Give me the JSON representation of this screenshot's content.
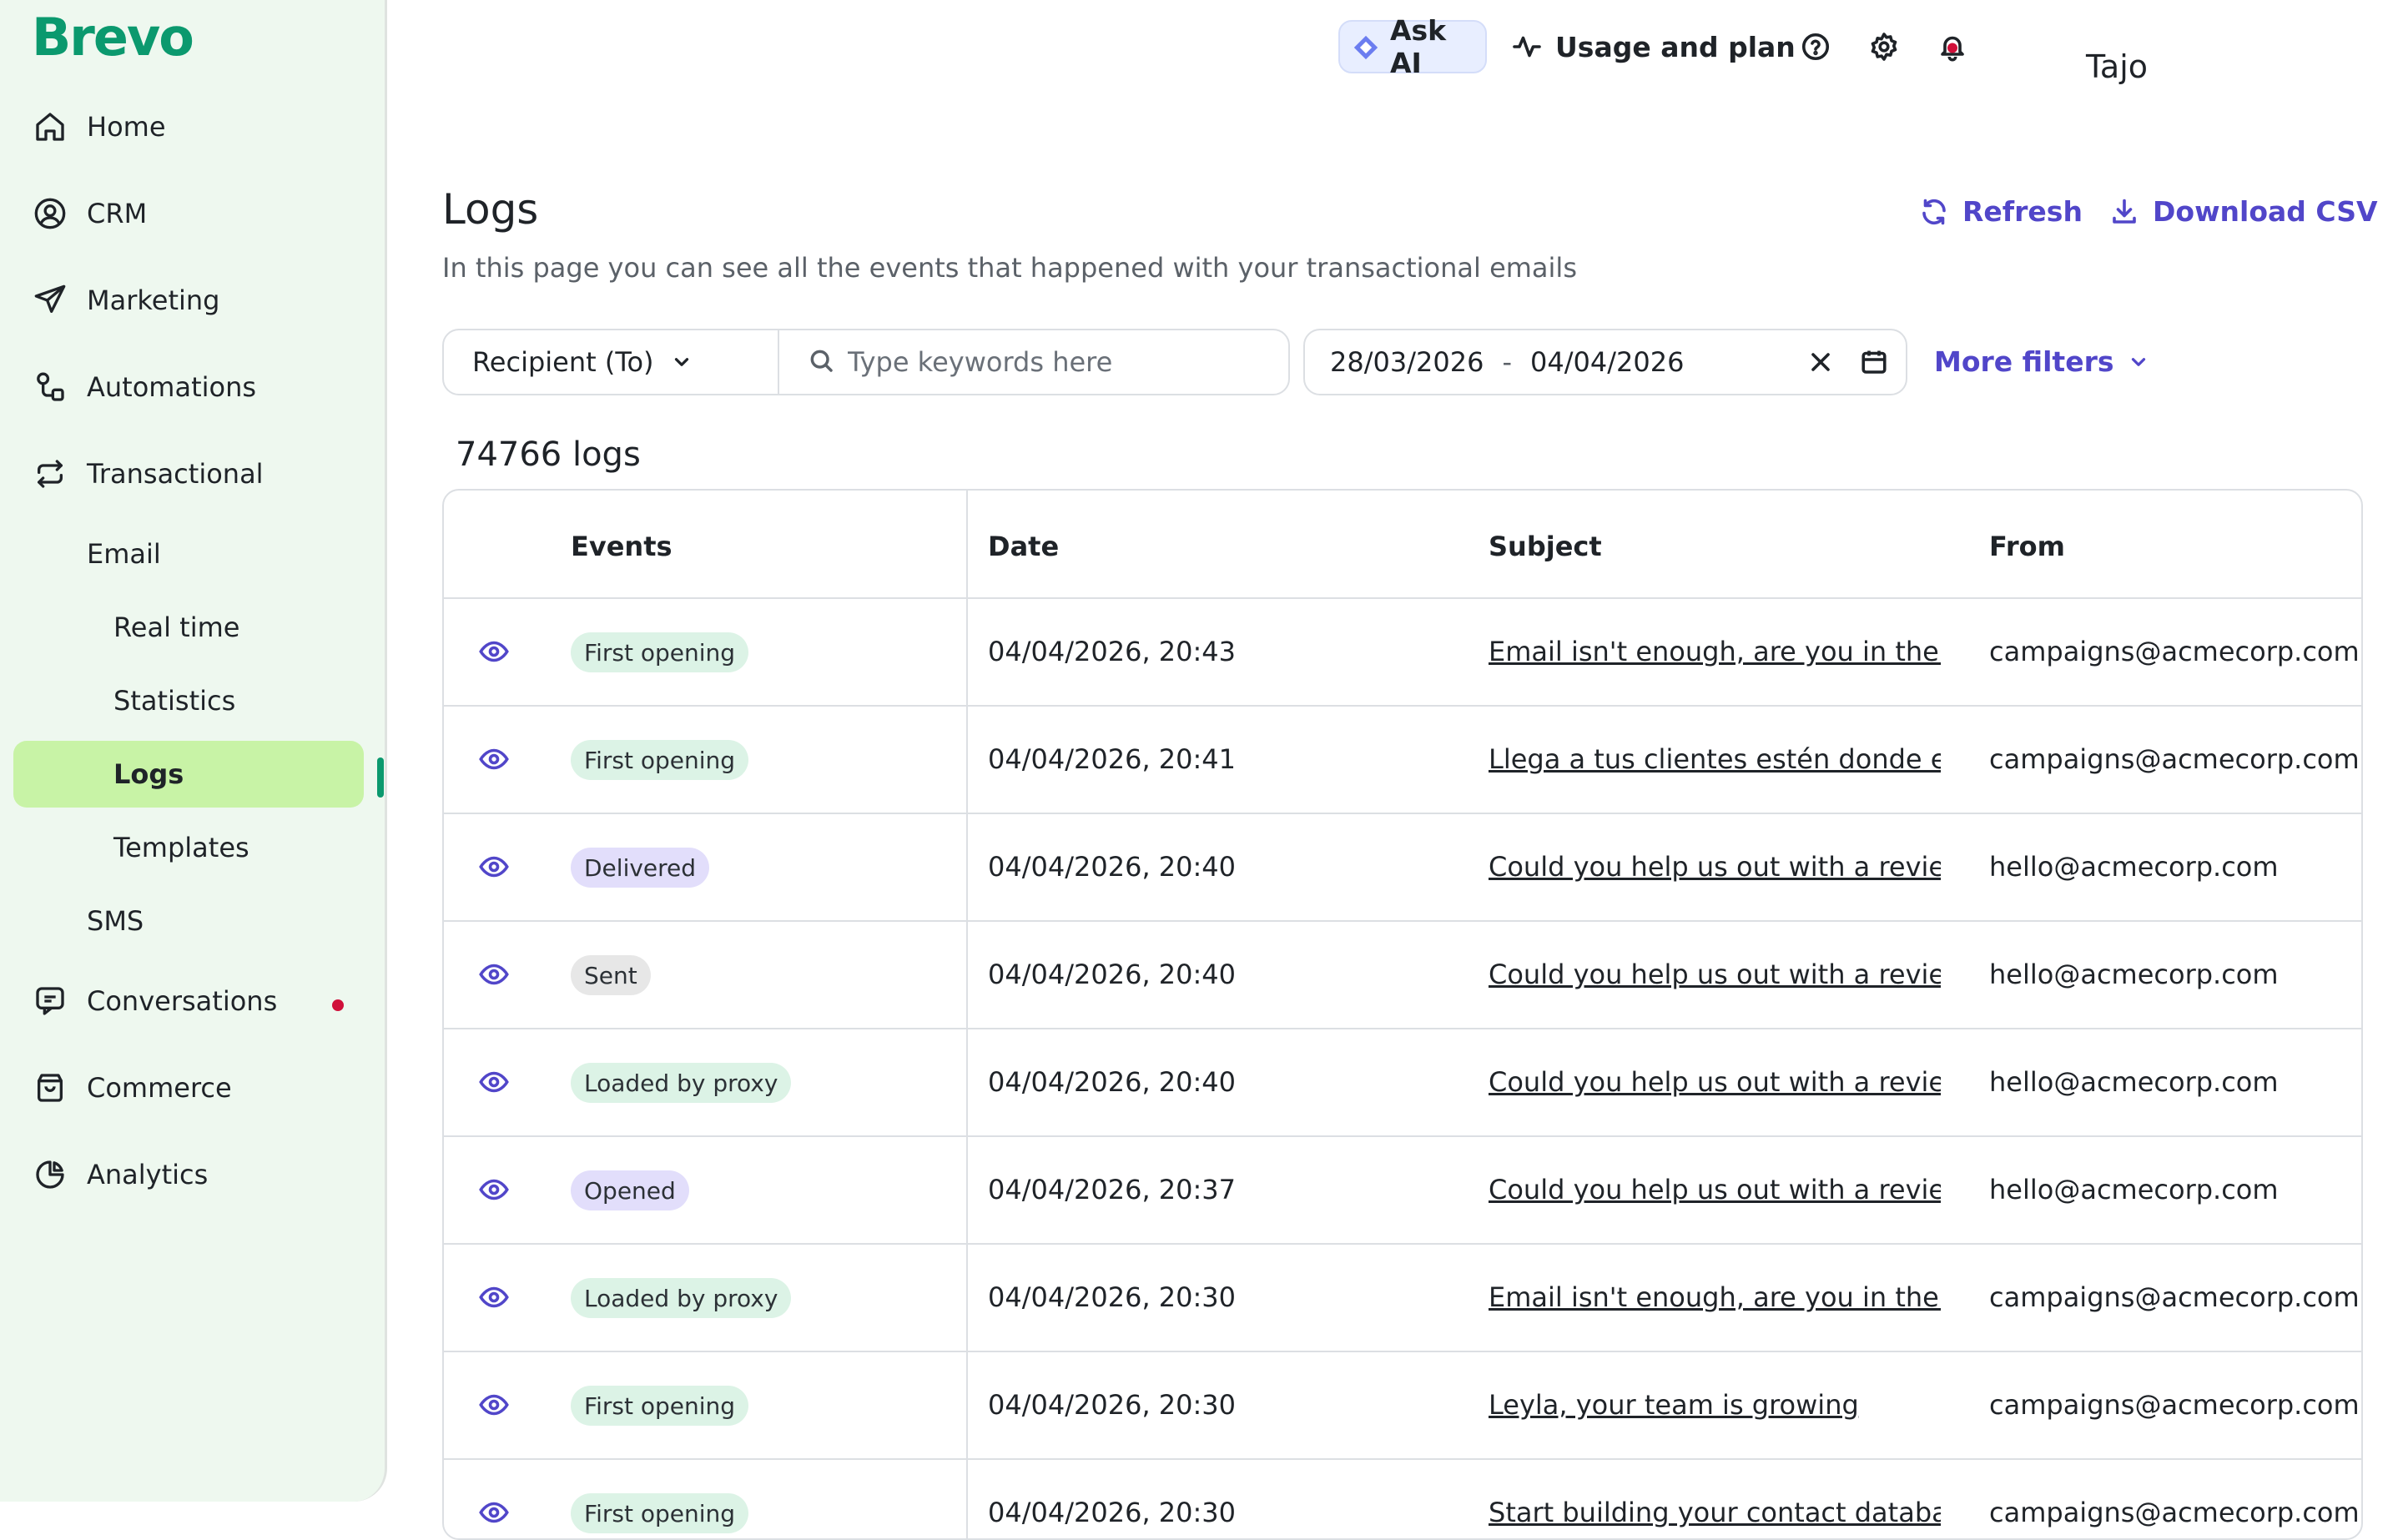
{
  "app": {
    "logo": "Brevo",
    "user_name": "Tajo"
  },
  "topbar": {
    "ask_ai_label": "Ask AI",
    "usage_label": "Usage and plan"
  },
  "sidebar": {
    "items": [
      {
        "label": "Home",
        "icon": "home-icon"
      },
      {
        "label": "CRM",
        "icon": "user-circle-icon"
      },
      {
        "label": "Marketing",
        "icon": "paper-plane-icon"
      },
      {
        "label": "Automations",
        "icon": "automation-icon"
      },
      {
        "label": "Transactional",
        "icon": "arrows-exchange-icon"
      },
      {
        "label": "Conversations",
        "icon": "chat-icon"
      },
      {
        "label": "Commerce",
        "icon": "shopping-bag-icon"
      },
      {
        "label": "Analytics",
        "icon": "pie-chart-icon"
      }
    ],
    "transactional_sub": {
      "email": "Email",
      "sms": "SMS"
    },
    "email_sub": [
      "Real time",
      "Statistics",
      "Logs",
      "Templates"
    ],
    "active_item": "Logs"
  },
  "header": {
    "title": "Logs",
    "subtitle": "In this page you can see all the events that happened with your transactional emails",
    "refresh_label": "Refresh",
    "download_label": "Download CSV"
  },
  "filters": {
    "recipient_label": "Recipient (To)",
    "keyword_placeholder": "Type keywords here",
    "date_from": "28/03/2026",
    "date_separator": "-",
    "date_to": "04/04/2026",
    "more_filters_label": "More filters"
  },
  "log_count": "74766 logs",
  "table": {
    "columns": [
      "Events",
      "Date",
      "Subject",
      "From"
    ],
    "rows": [
      {
        "event": "First opening",
        "event_color": "green",
        "date": "04/04/2026, 20:43",
        "subject": "Email isn't enough, are you in the right place?",
        "from": "campaigns@acmecorp.com"
      },
      {
        "event": "First opening",
        "event_color": "green",
        "date": "04/04/2026, 20:41",
        "subject": "Llega a tus clientes estén donde estén",
        "from": "campaigns@acmecorp.com"
      },
      {
        "event": "Delivered",
        "event_color": "purple",
        "date": "04/04/2026, 20:40",
        "subject": "Could you help us out with a review, Tajo?",
        "from": "hello@acmecorp.com"
      },
      {
        "event": "Sent",
        "event_color": "gray",
        "date": "04/04/2026, 20:40",
        "subject": "Could you help us out with a review, Tajo?",
        "from": "hello@acmecorp.com"
      },
      {
        "event": "Loaded by proxy",
        "event_color": "green",
        "date": "04/04/2026, 20:40",
        "subject": "Could you help us out with a review, Tajo?",
        "from": "hello@acmecorp.com"
      },
      {
        "event": "Opened",
        "event_color": "purple",
        "date": "04/04/2026, 20:37",
        "subject": "Could you help us out with a review, Tajo?",
        "from": "hello@acmecorp.com"
      },
      {
        "event": "Loaded by proxy",
        "event_color": "green",
        "date": "04/04/2026, 20:30",
        "subject": "Email isn't enough, are you in the right place?",
        "from": "campaigns@acmecorp.com"
      },
      {
        "event": "First opening",
        "event_color": "green",
        "date": "04/04/2026, 20:30",
        "subject": "Leyla, your team is growing",
        "from": "campaigns@acmecorp.com"
      },
      {
        "event": "First opening",
        "event_color": "green",
        "date": "04/04/2026, 20:30",
        "subject": "Start building your contact database",
        "from": "campaigns@acmecorp.com"
      }
    ]
  },
  "colors": {
    "brand": "#0b996e",
    "accent": "#5146c9",
    "active_bg": "#c8f3a6",
    "sidebar_bg": "#eef8ef",
    "notification_dot": "#d0103a"
  }
}
